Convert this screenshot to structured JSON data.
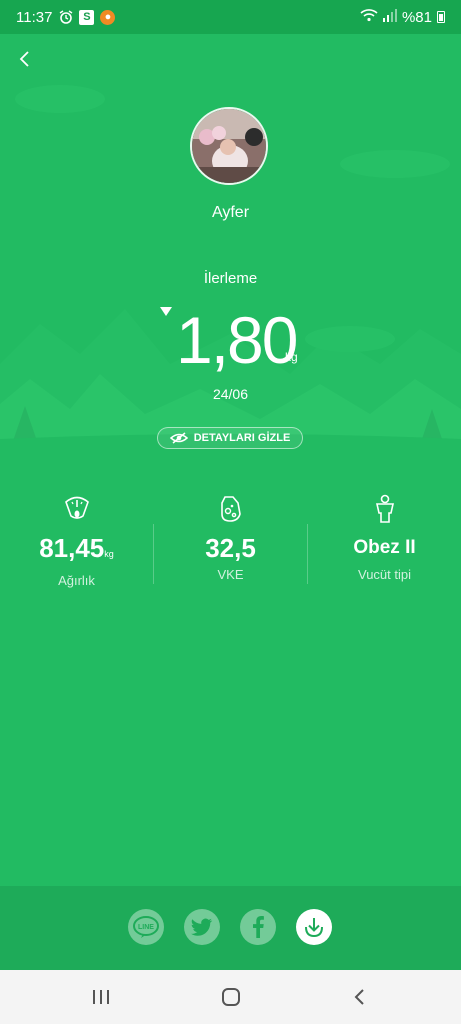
{
  "status_bar": {
    "time": "11:37",
    "battery_text": "%81",
    "icons": [
      "alarm-icon",
      "s-app-icon",
      "orange-app-icon",
      "wifi-icon",
      "signal-icon",
      "battery-icon"
    ]
  },
  "header": {
    "back_icon": "chevron-left-icon"
  },
  "profile": {
    "name": "Ayfer"
  },
  "progress": {
    "label": "İlerleme",
    "value": "1,80",
    "unit": "kg",
    "trend_icon": "triangle-down-icon",
    "date": "24/06",
    "details_button_label": "DETAYLARI GİZLE",
    "details_button_icon": "eye-hidden-icon"
  },
  "metrics": [
    {
      "icon": "scale-icon",
      "value": "81,45",
      "unit": "kg",
      "label": "Ağırlık"
    },
    {
      "icon": "body-fat-icon",
      "value": "32,5",
      "unit": "",
      "label": "VKE"
    },
    {
      "icon": "body-type-icon",
      "value": "Obez II",
      "unit": "",
      "label": "Vucüt tipi"
    }
  ],
  "share": {
    "buttons": [
      {
        "icon": "line-icon",
        "text": "LINE"
      },
      {
        "icon": "twitter-icon"
      },
      {
        "icon": "facebook-icon"
      },
      {
        "icon": "download-icon"
      }
    ]
  },
  "nav_bar": {
    "icons": [
      "recent-apps-icon",
      "home-icon",
      "back-icon"
    ]
  },
  "colors": {
    "primary_green": "#22bb62",
    "status_green": "#17a650",
    "share_bar_green": "#1eab59",
    "nav_bg": "#f4f4f4"
  }
}
